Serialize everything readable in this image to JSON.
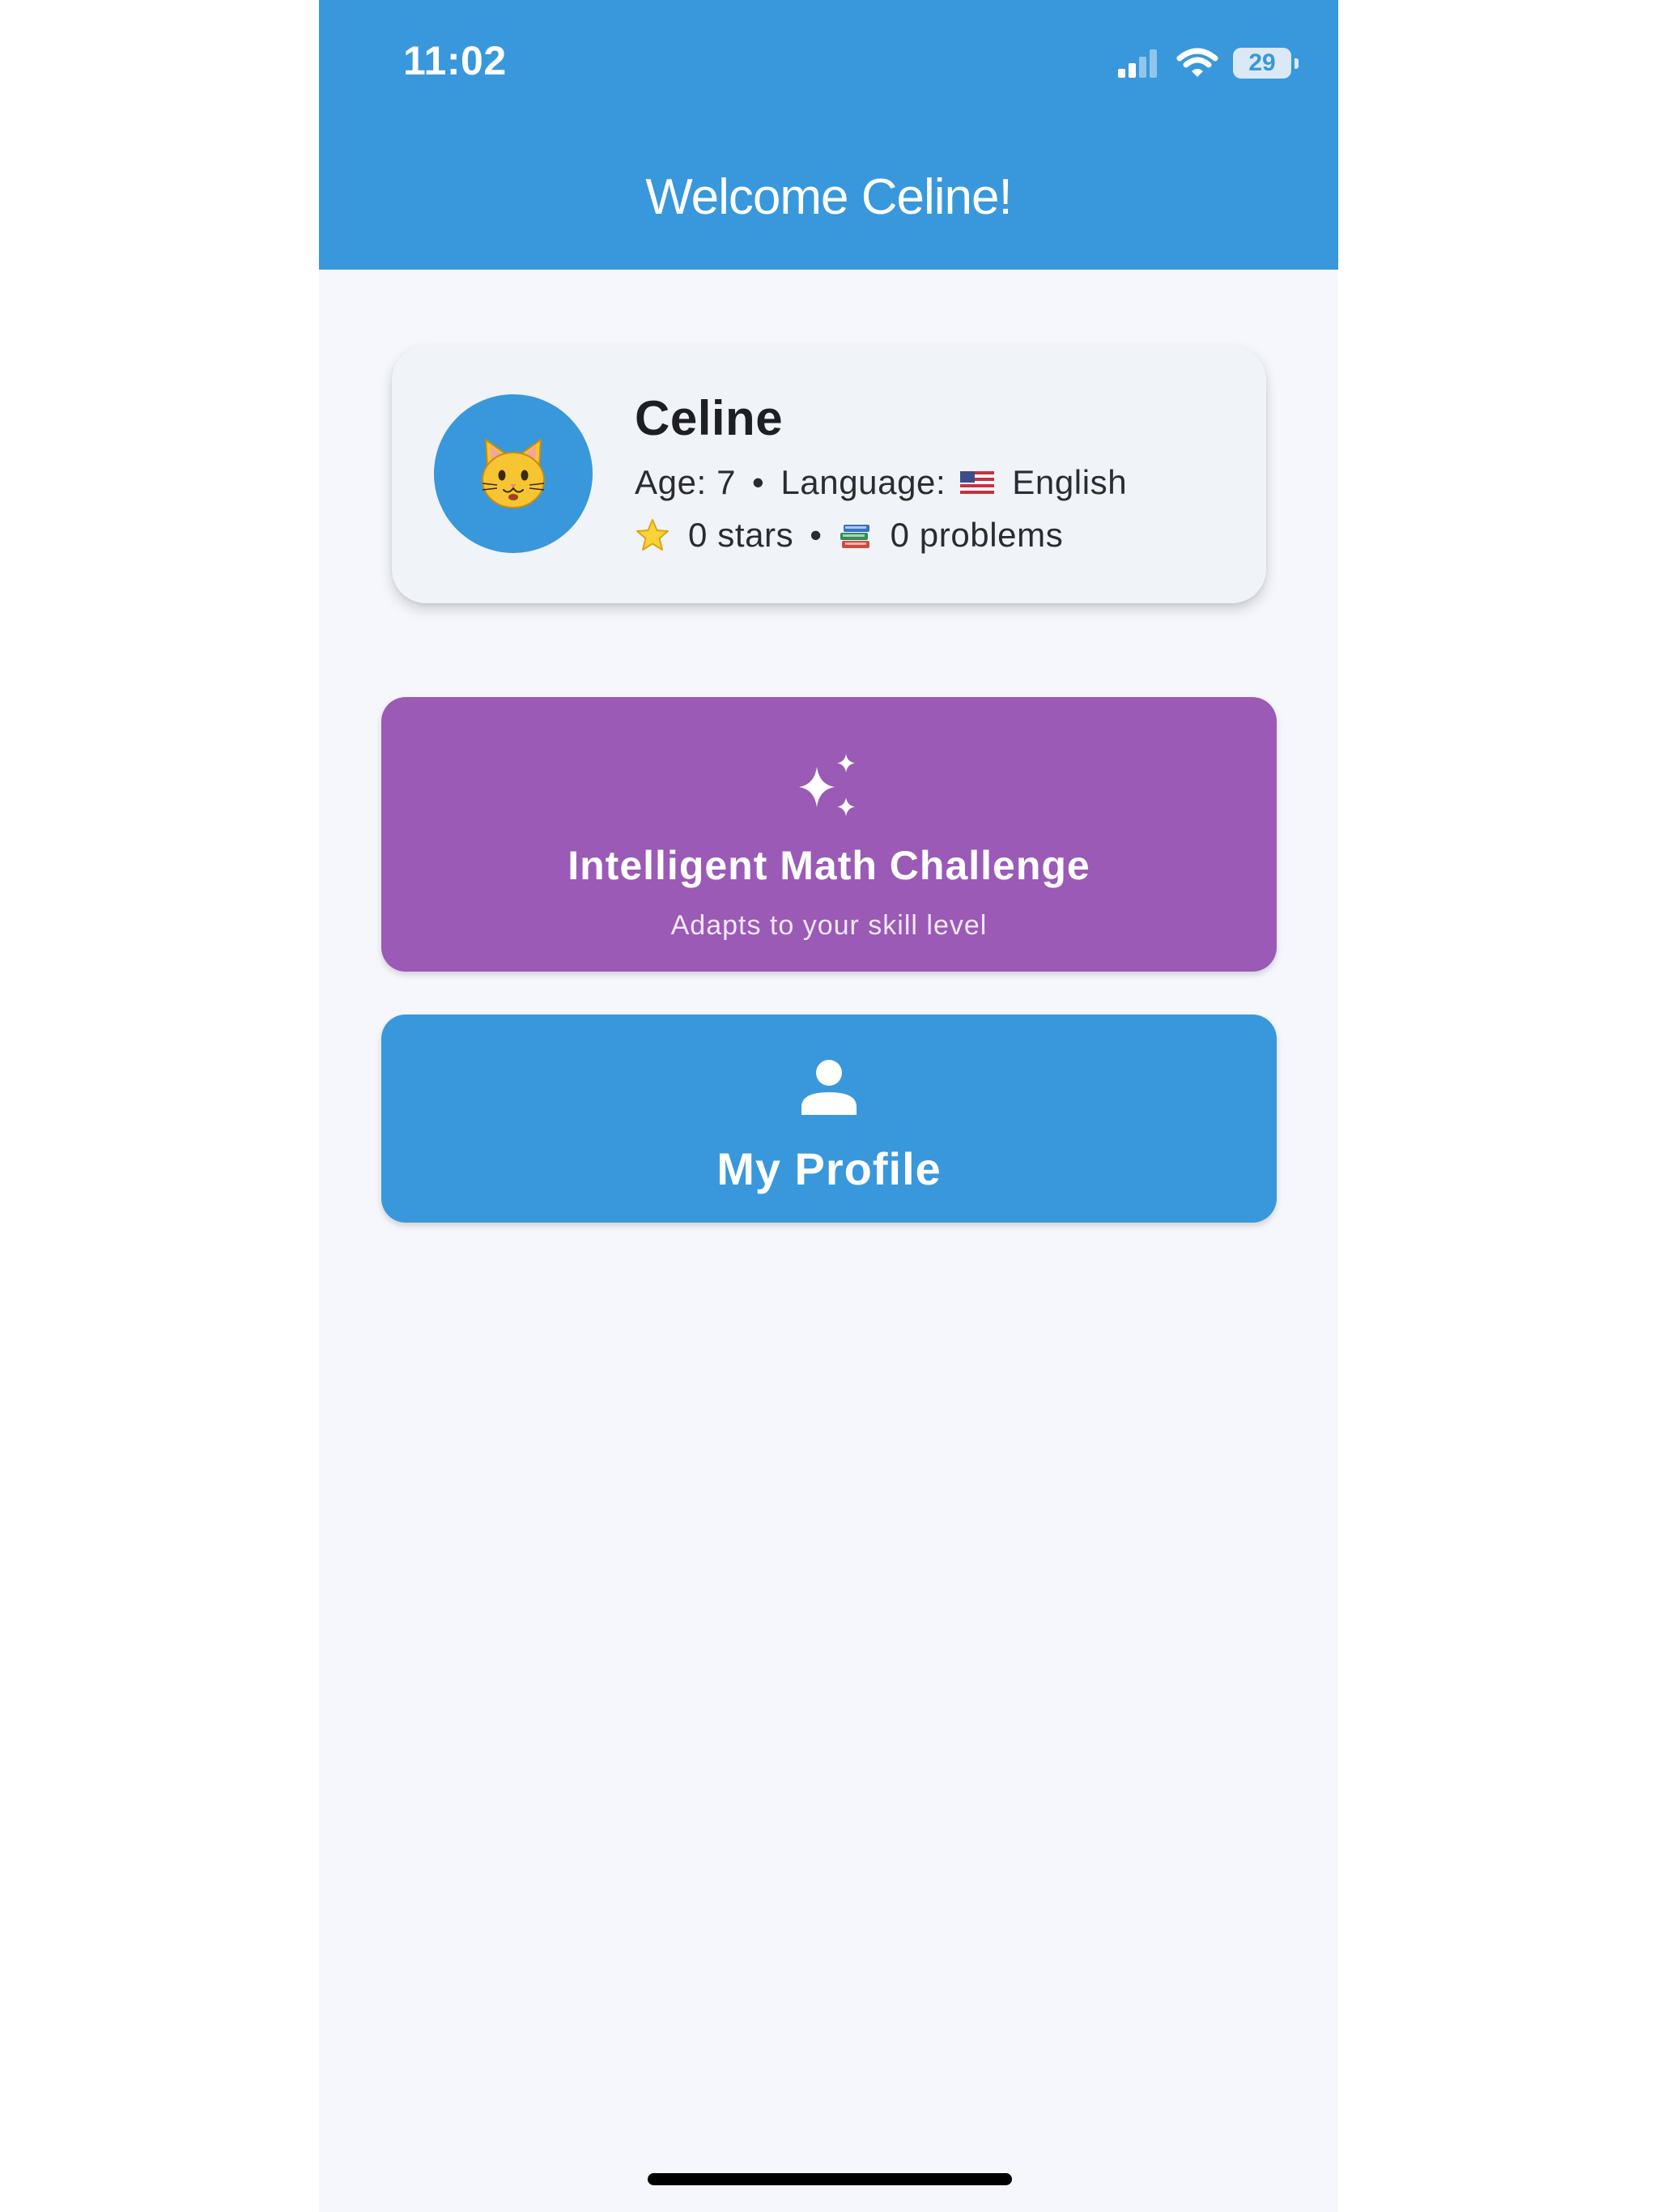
{
  "status_bar": {
    "time": "11:02",
    "battery": "29",
    "icons": [
      "cellular-signal-icon",
      "wifi-icon",
      "battery-icon"
    ]
  },
  "header": {
    "title": "Welcome Celine!"
  },
  "profile_card": {
    "avatar_icon": "cat-face-emoji",
    "name": "Celine",
    "age": "Age: 7",
    "separator": "•",
    "language_label": "Language:",
    "language_flag_icon": "us-flag-icon",
    "language": "English",
    "star_icon": "star-icon",
    "stars": "0 stars",
    "books_icon": "books-icon",
    "problems": "0 problems"
  },
  "actions": {
    "math_challenge": {
      "icon": "sparkles-icon",
      "title": "Intelligent Math Challenge",
      "subtitle": "Adapts to your skill level",
      "color": "#9a5ab6"
    },
    "my_profile": {
      "icon": "person-icon",
      "title": "My Profile",
      "color": "#3898db"
    }
  },
  "colors": {
    "primary": "#3898db",
    "accent_purple": "#9a5ab6",
    "background": "#f5f7fc",
    "card": "#f0f3f8"
  }
}
